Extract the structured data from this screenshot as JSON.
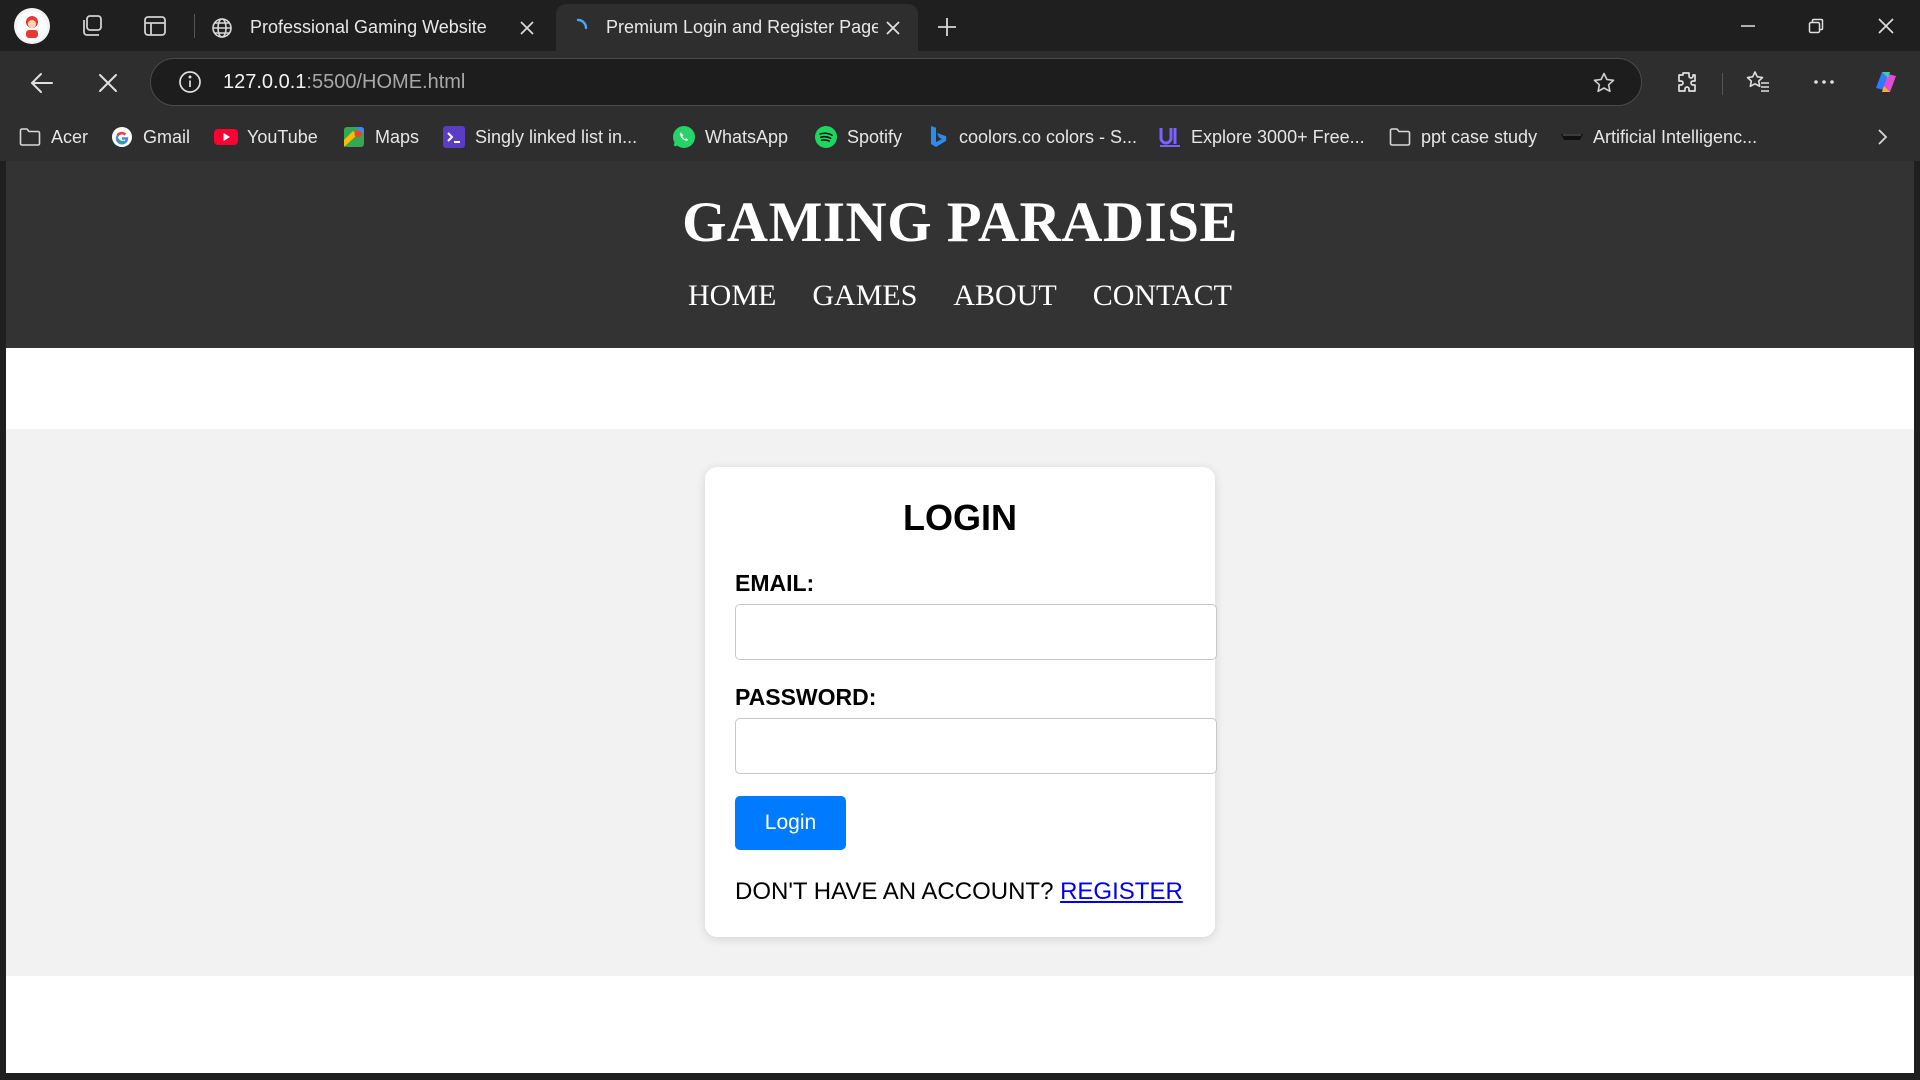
{
  "browser": {
    "tabs": [
      {
        "title": "Professional Gaming Website",
        "active": false
      },
      {
        "title": "Premium Login and Register Page",
        "active": true
      }
    ],
    "address": {
      "host": "127.0.0.1",
      "path": ":5500/HOME.html"
    },
    "bookmarks": [
      {
        "label": "Acer",
        "icon": "folder-icon"
      },
      {
        "label": "Gmail",
        "icon": "google-icon"
      },
      {
        "label": "YouTube",
        "icon": "youtube-icon"
      },
      {
        "label": "Maps",
        "icon": "maps-icon"
      },
      {
        "label": "Singly linked list in...",
        "icon": "terminal-icon"
      },
      {
        "label": "WhatsApp",
        "icon": "whatsapp-icon"
      },
      {
        "label": "Spotify",
        "icon": "spotify-icon"
      },
      {
        "label": "coolors.co colors - S...",
        "icon": "bing-icon"
      },
      {
        "label": "Explore 3000+ Free...",
        "icon": "ui-icon"
      },
      {
        "label": "ppt case study",
        "icon": "folder-icon"
      },
      {
        "label": "Artificial Intelligenc...",
        "icon": "ai-icon"
      }
    ],
    "colors": {
      "chrome": "#1f1f1f",
      "toolbar": "#2e2e2e"
    }
  },
  "site": {
    "title": "GAMING PARADISE",
    "nav": [
      "HOME",
      "GAMES",
      "ABOUT",
      "CONTACT"
    ],
    "colors": {
      "header": "#333333",
      "section": "#f2f2f2",
      "button": "#007bff",
      "link": "#0000ee"
    }
  },
  "login": {
    "heading": "LOGIN",
    "email_label": "EMAIL:",
    "email_value": "",
    "password_label": "PASSWORD:",
    "password_value": "",
    "button_label": "Login",
    "register_prompt": "DON'T HAVE AN ACCOUNT?",
    "register_link": "REGISTER"
  }
}
